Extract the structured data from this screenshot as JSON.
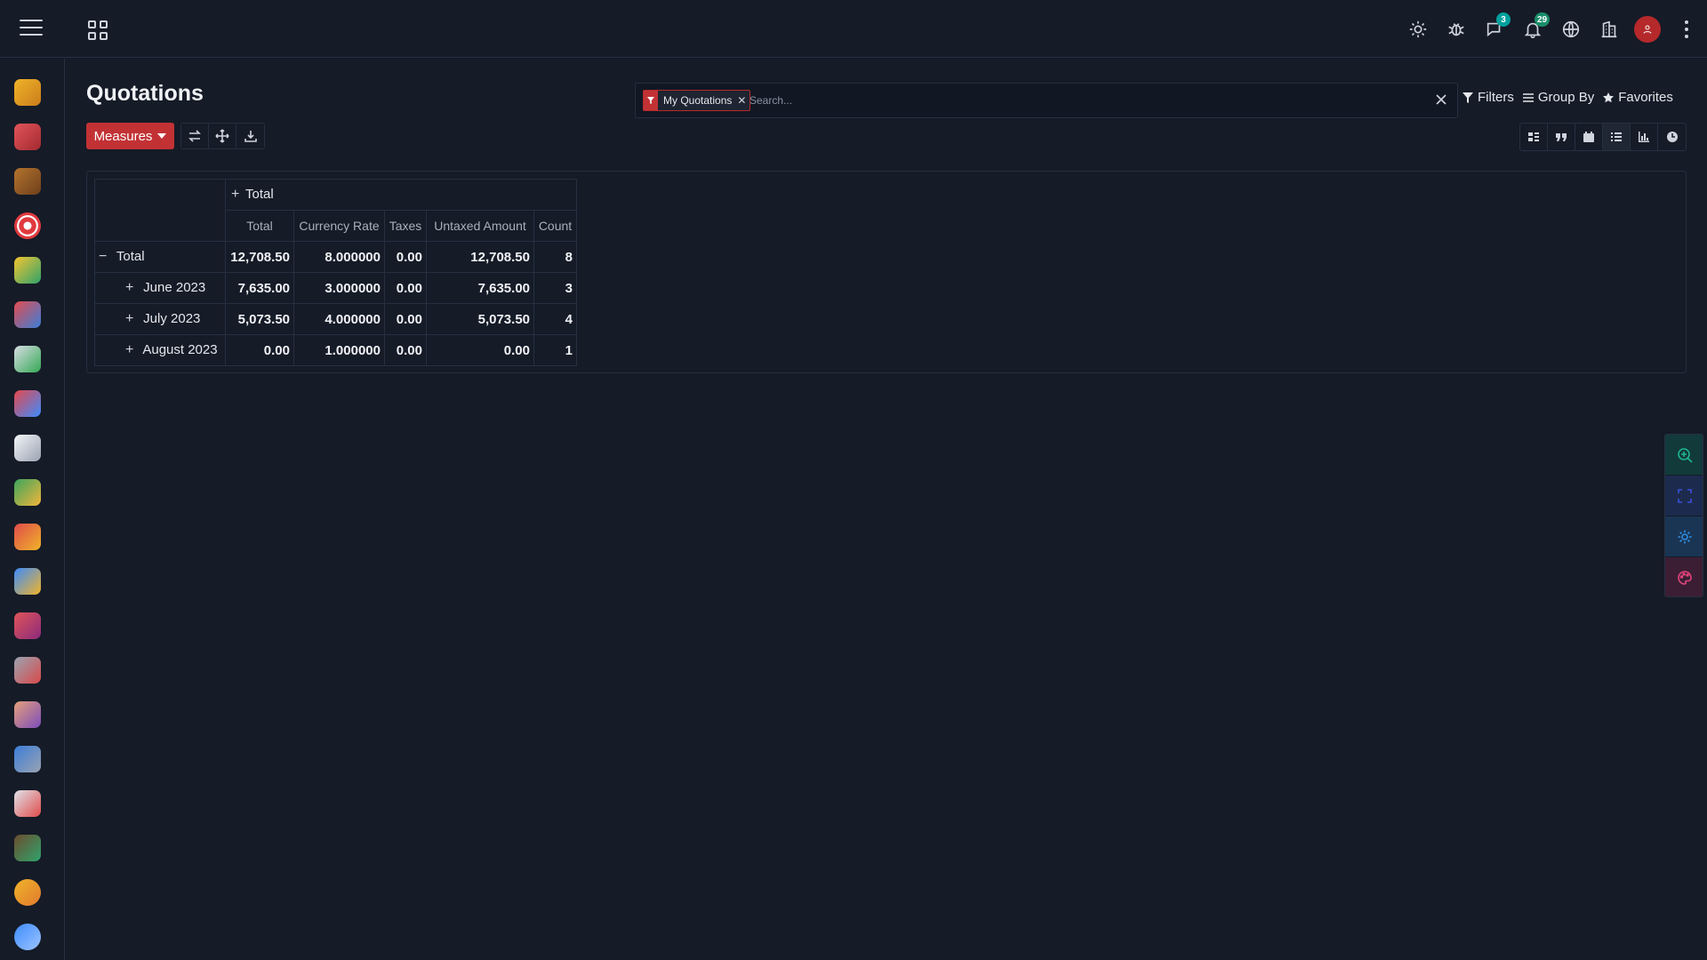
{
  "topbar": {
    "icons": [
      "hamburger-icon",
      "apps-icon",
      "sun-icon",
      "bug-icon",
      "chat-icon",
      "bell-icon",
      "globe-icon",
      "building-icon",
      "avatar",
      "kebab-icon"
    ],
    "chat_badge": "3",
    "notification_badge": "29"
  },
  "sidebar": {
    "apps": [
      "inbox-app",
      "calendar-app",
      "contacts-app",
      "crm-app",
      "sales-app",
      "point-of-sale-app",
      "invoicing-app",
      "project-app",
      "timesheets-app",
      "expenses-app",
      "purchase-app",
      "inventory-app",
      "manufacturing-app",
      "tools-app",
      "employees-app",
      "fleet-app",
      "recruitment-app",
      "wallet-app",
      "appraisal-app",
      "discuss-app"
    ]
  },
  "page": {
    "title": "Quotations",
    "measures_label": "Measures"
  },
  "search": {
    "facet_label": "My Quotations",
    "placeholder": "Search...",
    "filters_label": "Filters",
    "group_by_label": "Group By",
    "favorites_label": "Favorites"
  },
  "pivot": {
    "col_header": "Total",
    "measures": [
      "Total",
      "Currency Rate",
      "Taxes",
      "Untaxed Amount",
      "Count"
    ],
    "rows": [
      {
        "label": "Total",
        "values": [
          "12,708.50",
          "8.000000",
          "0.00",
          "12,708.50",
          "8"
        ]
      },
      {
        "label": "June 2023",
        "values": [
          "7,635.00",
          "3.000000",
          "0.00",
          "7,635.00",
          "3"
        ]
      },
      {
        "label": "July 2023",
        "values": [
          "5,073.50",
          "4.000000",
          "0.00",
          "5,073.50",
          "4"
        ]
      },
      {
        "label": "August 2023",
        "values": [
          "0.00",
          "1.000000",
          "0.00",
          "0.00",
          "1"
        ]
      }
    ]
  },
  "colors": {
    "accent": "#c23235",
    "background": "#151b27",
    "border": "#263042"
  }
}
